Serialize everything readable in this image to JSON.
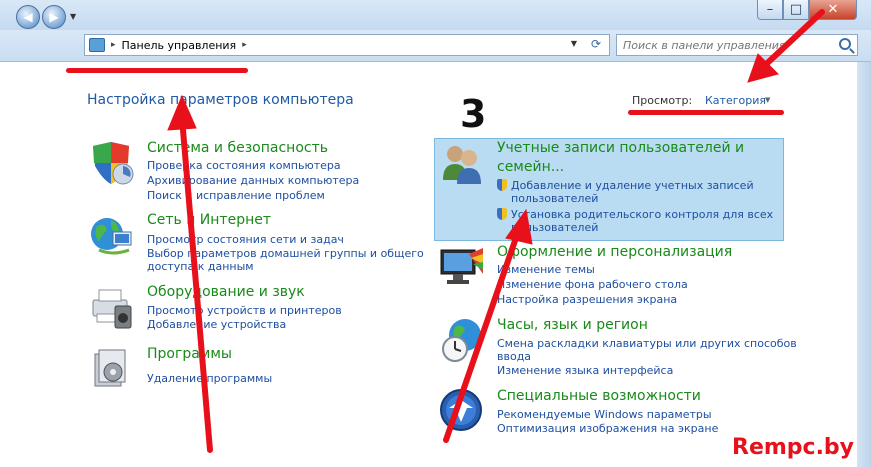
{
  "window": {
    "minimize": "–",
    "maximize": "□",
    "close": "✕"
  },
  "nav": {
    "back_icon": "arrow-left-icon",
    "forward_icon": "arrow-right-icon",
    "address": "Панель управления",
    "address_sep": "▸",
    "search_placeholder": "Поиск в панели управления"
  },
  "header": {
    "title": "Настройка параметров компьютера",
    "view_label": "Просмотр:",
    "view_value": "Категория"
  },
  "categories_left": [
    {
      "title": "Система и безопасность",
      "icon": "shield-icon",
      "links": [
        "Проверка состояния компьютера",
        "Архивирование данных компьютера",
        "Поиск и исправление проблем"
      ]
    },
    {
      "title": "Сеть и Интернет",
      "icon": "globe-network-icon",
      "links": [
        "Просмотр состояния сети и задач",
        "Выбор параметров домашней группы и общего",
        "доступа к данным"
      ]
    },
    {
      "title": "Оборудование и звук",
      "icon": "printer-icon",
      "links": [
        "Просмотр устройств и принтеров",
        "Добавление устройства"
      ]
    },
    {
      "title": "Программы",
      "icon": "programs-icon",
      "links": [
        "Удаление программы"
      ]
    }
  ],
  "categories_right": [
    {
      "title_line1": "Учетные записи пользователей и",
      "title_line2": "семейн...",
      "icon": "users-icon",
      "links": [
        "Добавление и удаление учетных записей",
        "пользователей",
        "Установка родительского контроля для всех",
        "пользователей"
      ]
    },
    {
      "title": "Оформление и персонализация",
      "icon": "monitor-paint-icon",
      "links": [
        "Изменение темы",
        "Изменение фона рабочего стола",
        "Настройка разрешения экрана"
      ]
    },
    {
      "title": "Часы, язык и регион",
      "icon": "clock-globe-icon",
      "links": [
        "Смена раскладки клавиатуры или других способов",
        "ввода",
        "Изменение языка интерфейса"
      ]
    },
    {
      "title": "Специальные возможности",
      "icon": "accessibility-icon",
      "links": [
        "Рекомендуемые Windows параметры",
        "Оптимизация изображения на экране"
      ]
    }
  ],
  "annotations": {
    "step_number": "3",
    "watermark": "Rempc.by",
    "color": "#e8101a"
  }
}
